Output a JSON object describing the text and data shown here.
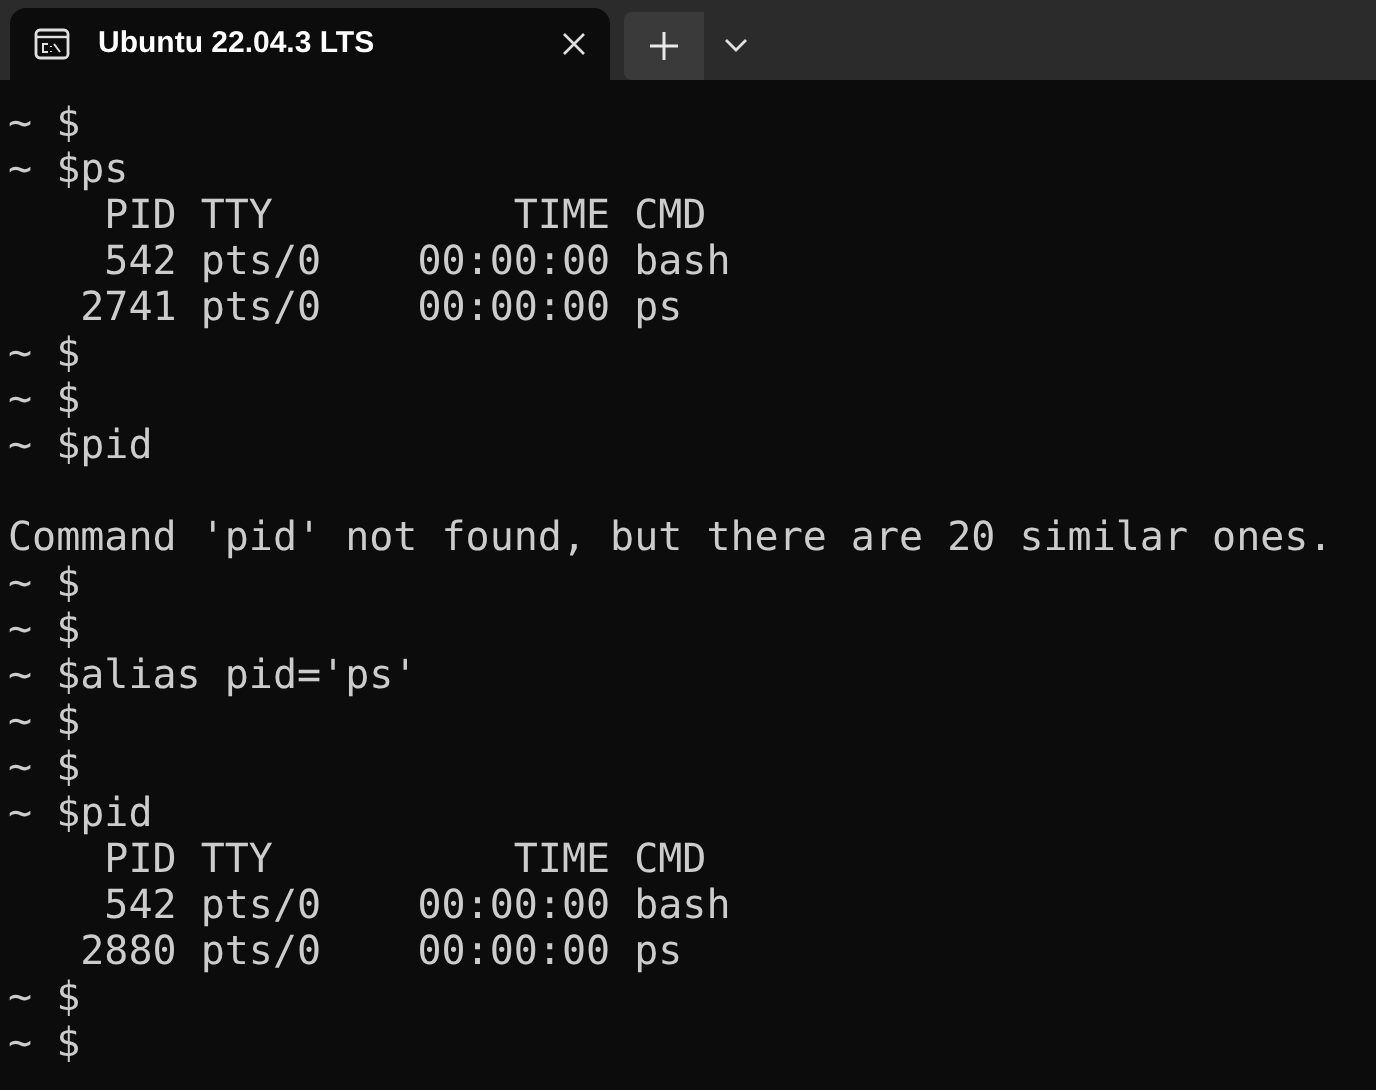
{
  "tab": {
    "title": "Ubuntu 22.04.3 LTS",
    "selected": true
  },
  "terminal": {
    "lines": [
      {
        "kind": "prompt",
        "prompt": "~ $"
      },
      {
        "kind": "prompt",
        "prompt": "~ $",
        "command": "ps"
      },
      {
        "kind": "output",
        "text": "    PID TTY          TIME CMD"
      },
      {
        "kind": "output",
        "text": "    542 pts/0    00:00:00 bash"
      },
      {
        "kind": "output",
        "text": "   2741 pts/0    00:00:00 ps"
      },
      {
        "kind": "prompt",
        "prompt": "~ $"
      },
      {
        "kind": "prompt",
        "prompt": "~ $"
      },
      {
        "kind": "prompt",
        "prompt": "~ $",
        "command": "pid"
      },
      {
        "kind": "blank"
      },
      {
        "kind": "output",
        "text": "Command 'pid' not found, but there are 20 similar ones."
      },
      {
        "kind": "prompt",
        "prompt": "~ $"
      },
      {
        "kind": "prompt",
        "prompt": "~ $"
      },
      {
        "kind": "prompt",
        "prompt": "~ $",
        "command": "alias pid='ps'"
      },
      {
        "kind": "prompt",
        "prompt": "~ $"
      },
      {
        "kind": "prompt",
        "prompt": "~ $"
      },
      {
        "kind": "prompt",
        "prompt": "~ $",
        "command": "pid"
      },
      {
        "kind": "output",
        "text": "    PID TTY          TIME CMD"
      },
      {
        "kind": "output",
        "text": "    542 pts/0    00:00:00 bash"
      },
      {
        "kind": "output",
        "text": "   2880 pts/0    00:00:00 ps"
      },
      {
        "kind": "prompt",
        "prompt": "~ $"
      },
      {
        "kind": "prompt",
        "prompt": "~ $"
      }
    ]
  }
}
